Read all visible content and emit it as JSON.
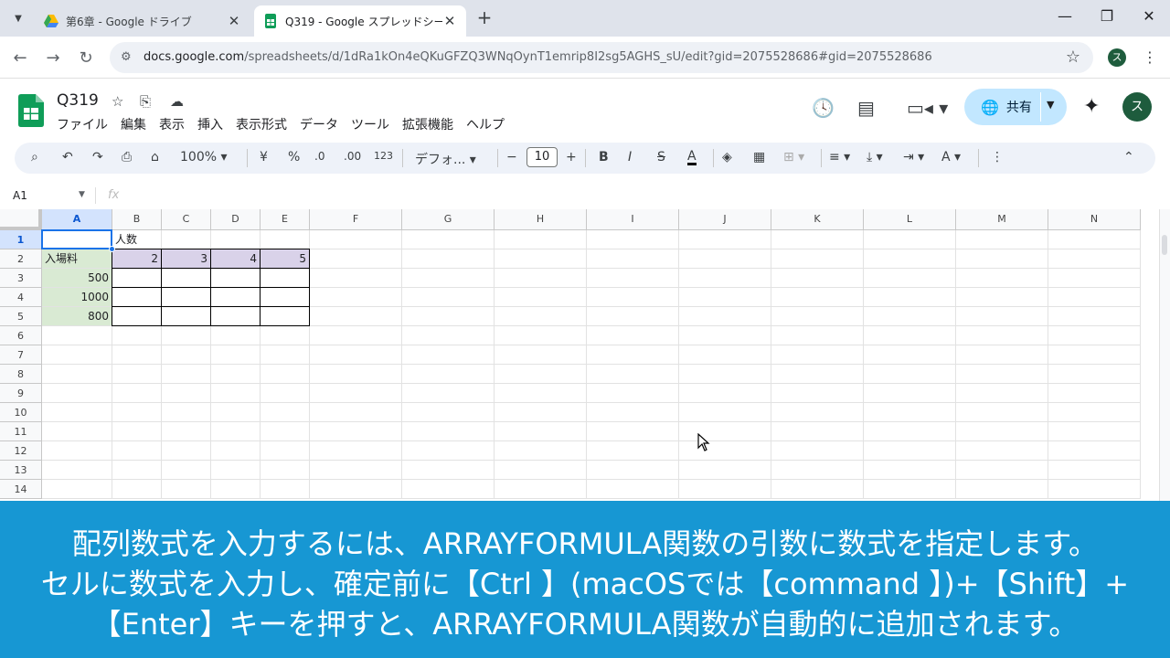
{
  "browser": {
    "tabs": [
      {
        "title": "第6章 - Google ドライブ",
        "active": false
      },
      {
        "title": "Q319 - Google スプレッドシート",
        "active": true
      }
    ],
    "url_host": "docs.google.com",
    "url_path": "/spreadsheets/d/1dRa1kOn4eQKuGFZQ3WNqOynT1emrip8I2sg5AGHS_sU/edit?gid=2075528686#gid=2075528686",
    "profile_initial": "ス"
  },
  "doc": {
    "title": "Q319",
    "menu": [
      "ファイル",
      "編集",
      "表示",
      "挿入",
      "表示形式",
      "データ",
      "ツール",
      "拡張機能",
      "ヘルプ"
    ],
    "share_label": "共有",
    "account_initial": "ス"
  },
  "toolbar": {
    "zoom": "100%",
    "currency": "¥",
    "percent": "%",
    "dec_decrease": ".0",
    "dec_increase": ".00",
    "number_format": "123",
    "font": "デフォ...",
    "font_size": "10",
    "bold": "B",
    "italic": "I",
    "strike": "S",
    "text_color": "A"
  },
  "formula_bar": {
    "name_box": "A1",
    "fx": "fx"
  },
  "sheet": {
    "columns": [
      "A",
      "B",
      "C",
      "D",
      "E",
      "F",
      "G",
      "H",
      "I",
      "J",
      "K",
      "L",
      "M",
      "N"
    ],
    "rows": [
      "1",
      "2",
      "3",
      "4",
      "5",
      "6",
      "7",
      "8",
      "9",
      "10",
      "11",
      "12",
      "13",
      "14"
    ],
    "selected_cell": "A1",
    "cells": {
      "B1": "人数",
      "A2": "入場料",
      "B2": "2",
      "C2": "3",
      "D2": "4",
      "E2": "5",
      "A3": "500",
      "A4": "1000",
      "A5": "800"
    }
  },
  "caption": {
    "line1": "配列数式を入力するには、ARRAYFORMULA関数の引数に数式を指定します。",
    "line2": "セルに数式を入力し、確定前に【Ctrl 】(macOSでは【command 】)+【Shift】+",
    "line3": "【Enter】キーを押すと、ARRAYFORMULA関数が自動的に追加されます。"
  },
  "colors": {
    "header_fill_green": "#d9ead3",
    "header_fill_purple": "#d9d2e9",
    "caption_bg": "#1797d3",
    "selection_blue": "#1a73e8"
  }
}
